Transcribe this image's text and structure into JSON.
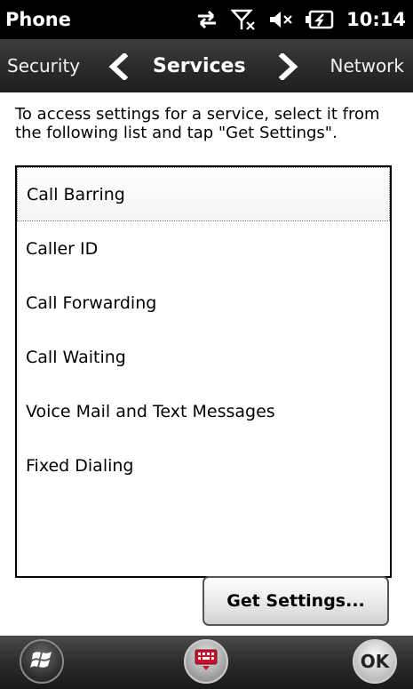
{
  "status_bar": {
    "app_title": "Phone",
    "time": "10:14",
    "icons": [
      "data-sync-icon",
      "no-signal-icon",
      "volume-muted-icon",
      "battery-charging-icon"
    ]
  },
  "tab_bar": {
    "prev_tab": "Security",
    "current_tab": "Services",
    "next_tab": "Network"
  },
  "instructions": "To access settings for a service, select it from the following list and tap \"Get Settings\".",
  "services": {
    "items": [
      "Call Barring",
      "Caller ID",
      "Call Forwarding",
      "Call Waiting",
      "Voice Mail and Text Messages",
      "Fixed Dialing"
    ],
    "selected": "Call Barring"
  },
  "actions": {
    "get_settings_label": "Get Settings..."
  },
  "bottom_bar": {
    "ok_label": "OK",
    "keyboard_color": "#c8102e"
  }
}
